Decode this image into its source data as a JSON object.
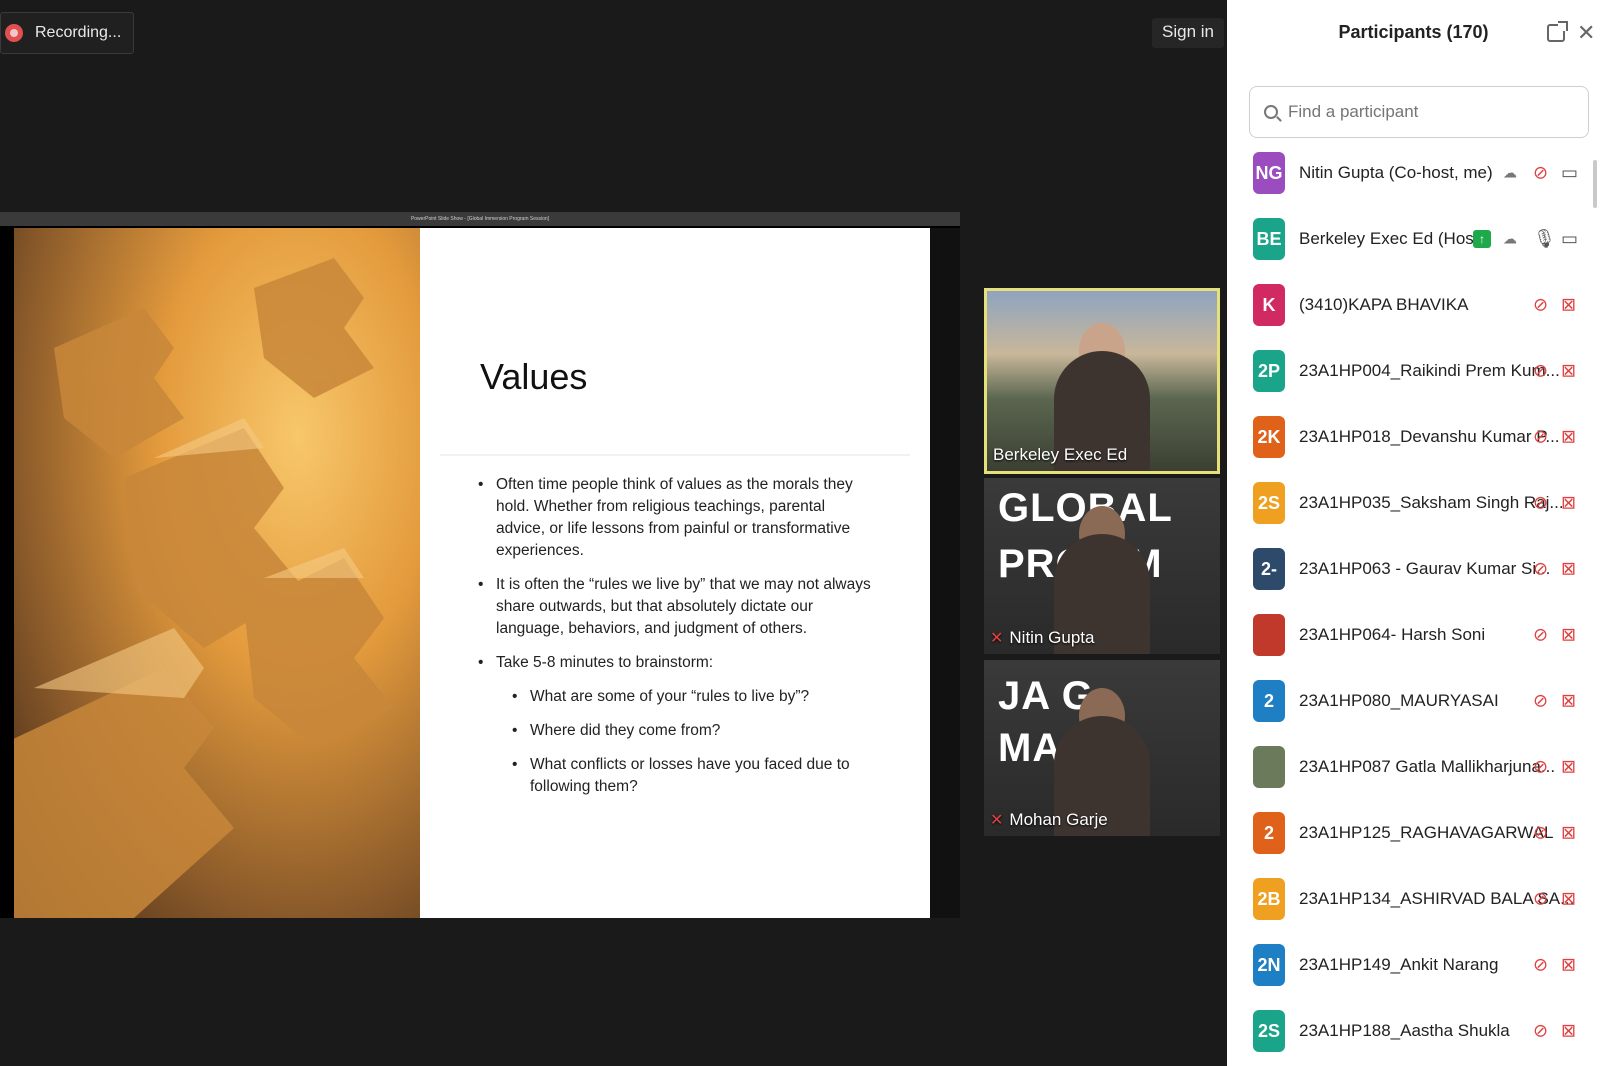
{
  "recording": {
    "label": "Recording..."
  },
  "signin": {
    "label": "Sign in"
  },
  "share": {
    "window_title": "PowerPoint Slide Show - [Global Immersion Program Session]",
    "slide": {
      "heading": "Values",
      "bullets": [
        "Often time people think of values as the morals they hold. Whether from religious teachings, parental advice, or life lessons from painful or transformative experiences.",
        "It is often the “rules we live by” that we may not always share outwards, but that absolutely dictate our language, behaviors, and judgment of others.",
        "Take 5-8 minutes to brainstorm:"
      ],
      "sub_bullets": [
        "What are some of your “rules to live by”?",
        "Where did they come from?",
        "What conflicts or losses have you faced due to following them?"
      ]
    }
  },
  "tiles": [
    {
      "name": "Berkeley Exec Ed",
      "muted": false
    },
    {
      "name": "Nitin Gupta",
      "muted": true,
      "bg_text_1": "GLOBAL",
      "bg_text_2": "PRO  AM"
    },
    {
      "name": "Mohan Garje",
      "muted": true,
      "bg_text_1": "JA  G",
      "bg_text_2": "MA  RO"
    }
  ],
  "panel": {
    "title": "Participants (170)",
    "search_placeholder": "Find a participant",
    "participants": [
      {
        "initials": "NG",
        "name": "Nitin Gupta (Co-host, me)",
        "color": "#9b4dbf",
        "mic": "muted",
        "cam": "on",
        "cloud": true,
        "share": false
      },
      {
        "initials": "BE",
        "name": "Berkeley Exec Ed (Host)",
        "color": "#1aa58a",
        "mic": "on",
        "cam": "on",
        "cloud": true,
        "share": true
      },
      {
        "initials": "K",
        "name": "(3410)KAPA BHAVIKA",
        "color": "#d12a63",
        "mic": "muted",
        "cam": "off",
        "cloud": false,
        "share": false
      },
      {
        "initials": "2P",
        "name": "23A1HP004_Raikindi Prem Kum...",
        "color": "#1aa58a",
        "mic": "muted",
        "cam": "off",
        "cloud": false,
        "share": false
      },
      {
        "initials": "2K",
        "name": "23A1HP018_Devanshu Kumar P...",
        "color": "#e0621a",
        "mic": "muted",
        "cam": "off",
        "cloud": false,
        "share": false
      },
      {
        "initials": "2S",
        "name": "23A1HP035_Saksham Singh Raj...",
        "color": "#f0a020",
        "mic": "muted",
        "cam": "off",
        "cloud": false,
        "share": false
      },
      {
        "initials": "2-",
        "name": "23A1HP063 - Gaurav Kumar Si...",
        "color": "#2d4a6a",
        "mic": "muted",
        "cam": "off",
        "cloud": false,
        "share": false
      },
      {
        "initials": "",
        "name": "23A1HP064- Harsh Soni",
        "color": "#c0392b",
        "mic": "muted",
        "cam": "off",
        "cloud": false,
        "share": false
      },
      {
        "initials": "2",
        "name": "23A1HP080_MAURYASAI",
        "color": "#1f7fc4",
        "mic": "muted",
        "cam": "off",
        "cloud": false,
        "share": false
      },
      {
        "initials": "",
        "name": "23A1HP087 Gatla Mallikharjuna...",
        "color": "#6b7a5a",
        "mic": "muted",
        "cam": "off",
        "cloud": false,
        "share": false
      },
      {
        "initials": "2",
        "name": "23A1HP125_RAGHAVAGARWAL",
        "color": "#e0621a",
        "mic": "muted",
        "cam": "off",
        "cloud": false,
        "share": false
      },
      {
        "initials": "2B",
        "name": "23A1HP134_ASHIRVAD BALA SA...",
        "color": "#f0a020",
        "mic": "muted",
        "cam": "off",
        "cloud": false,
        "share": false
      },
      {
        "initials": "2N",
        "name": "23A1HP149_Ankit Narang",
        "color": "#1f7fc4",
        "mic": "muted",
        "cam": "off",
        "cloud": false,
        "share": false
      },
      {
        "initials": "2S",
        "name": "23A1HP188_Aastha Shukla",
        "color": "#1aa58a",
        "mic": "muted",
        "cam": "off",
        "cloud": false,
        "share": false
      }
    ]
  },
  "icons": {
    "mic_muted": "microphone-muted-icon",
    "mic_on": "microphone-icon",
    "cam_off": "video-off-icon",
    "cam_on": "video-icon",
    "cloud": "cloud-recording-icon",
    "share": "share-screen-icon",
    "popout": "popout-icon",
    "close": "close-icon",
    "search": "search-icon"
  }
}
